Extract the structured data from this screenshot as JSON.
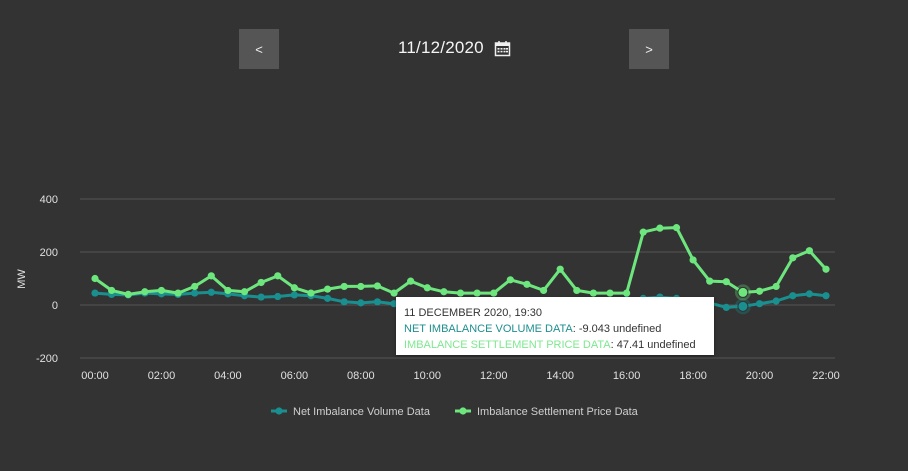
{
  "nav": {
    "prev_label": "<",
    "next_label": ">",
    "date": "11/12/2020",
    "calendar_icon": "calendar-icon"
  },
  "colors": {
    "background": "#333333",
    "niv": "#1a8f8f",
    "price": "#6ee67e",
    "grid": "#555555"
  },
  "chart_data": {
    "type": "line",
    "ylabel": "MW",
    "xlabel": "",
    "ylim": [
      -200,
      400
    ],
    "yticks": [
      "400",
      "200",
      "0",
      "-200"
    ],
    "yticks_values": [
      400,
      200,
      0,
      -200
    ],
    "xticks": [
      "00:00",
      "02:00",
      "04:00",
      "06:00",
      "08:00",
      "10:00",
      "12:00",
      "14:00",
      "16:00",
      "18:00",
      "20:00",
      "22:00"
    ],
    "x": [
      "00:00",
      "00:30",
      "01:00",
      "01:30",
      "02:00",
      "02:30",
      "03:00",
      "03:30",
      "04:00",
      "04:30",
      "05:00",
      "05:30",
      "06:00",
      "06:30",
      "07:00",
      "07:30",
      "08:00",
      "08:30",
      "09:00",
      "09:30",
      "10:00",
      "10:30",
      "11:00",
      "11:30",
      "12:00",
      "12:30",
      "13:00",
      "13:30",
      "14:00",
      "14:30",
      "15:00",
      "15:30",
      "16:00",
      "16:30",
      "17:00",
      "17:30",
      "18:00",
      "18:30",
      "19:00",
      "19:30",
      "20:00",
      "20:30",
      "21:00",
      "21:30",
      "22:00"
    ],
    "grid": true,
    "legend_position": "bottom",
    "series": [
      {
        "name": "Net Imbalance Volume Data",
        "color": "#1a8f8f",
        "values": [
          45,
          40,
          38,
          45,
          42,
          40,
          45,
          48,
          42,
          35,
          30,
          32,
          38,
          35,
          25,
          12,
          8,
          12,
          5,
          5,
          -8,
          -5,
          -12,
          -8,
          -10,
          -5,
          0,
          5,
          0,
          -5,
          5,
          10,
          20,
          25,
          30,
          25,
          15,
          8,
          -9.043,
          -5,
          5,
          15,
          35,
          42,
          35
        ]
      },
      {
        "name": "Imbalance Settlement Price Data",
        "color": "#6ee67e",
        "values": [
          100,
          55,
          40,
          50,
          55,
          45,
          70,
          110,
          55,
          50,
          85,
          110,
          65,
          45,
          60,
          70,
          70,
          72,
          45,
          90,
          65,
          50,
          45,
          45,
          45,
          95,
          78,
          55,
          135,
          55,
          45,
          45,
          45,
          275,
          290,
          292,
          170,
          90,
          88,
          47.41,
          52,
          70,
          178,
          205,
          135
        ]
      }
    ],
    "tooltip": {
      "header": "11 DECEMBER 2020, 19:30",
      "line1_label": "NET IMBALANCE VOLUME DATA",
      "line1_value": ": -9.043 undefined",
      "line2_label": "IMBALANCE SETTLEMENT PRICE DATA",
      "line2_value": ": 47.41 undefined"
    }
  }
}
